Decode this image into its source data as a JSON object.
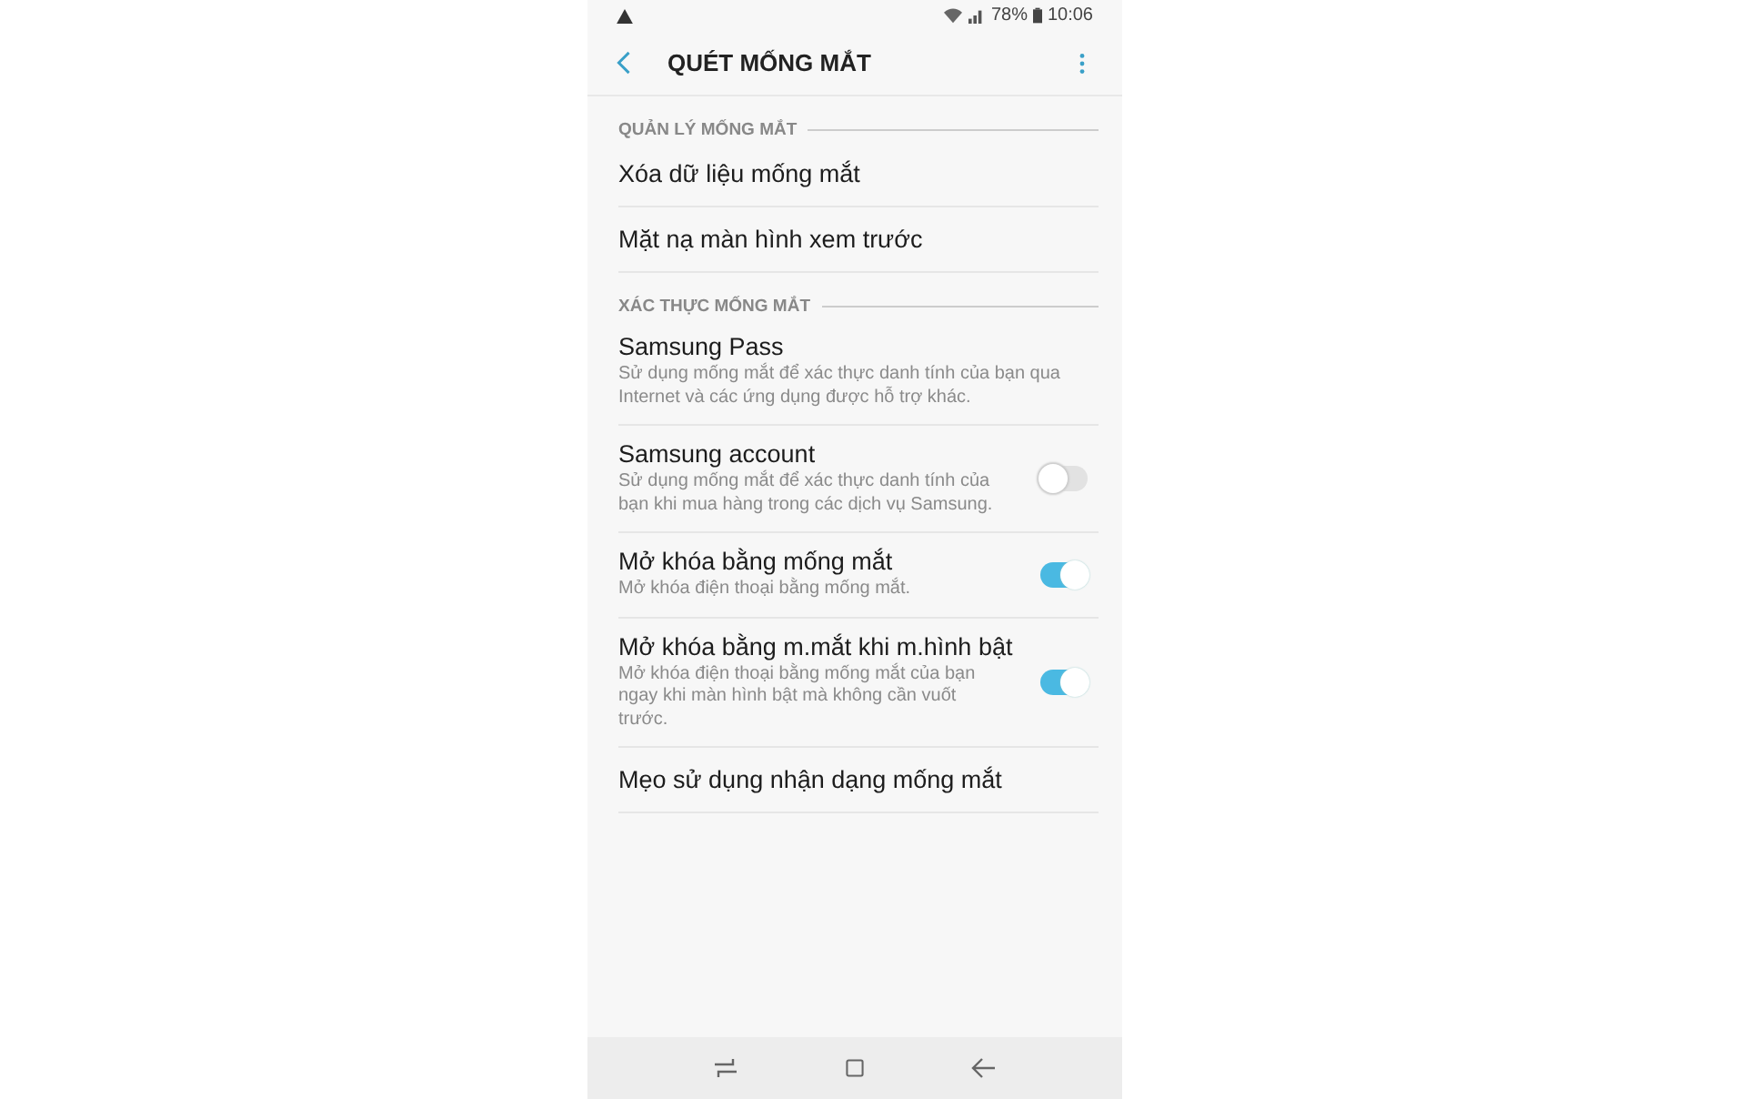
{
  "status_bar": {
    "battery": "78%",
    "time": "10:06"
  },
  "header": {
    "title": "QUÉT MỐNG MẮT"
  },
  "sections": [
    {
      "title": "QUẢN LÝ MỐNG MẮT",
      "items": [
        {
          "kind": "link",
          "title": "Xóa dữ liệu mống mắt"
        },
        {
          "kind": "link",
          "title": "Mặt nạ màn hình xem trước"
        }
      ]
    },
    {
      "title": "XÁC THỰC MỐNG MẮT",
      "items": [
        {
          "kind": "link",
          "title": "Samsung Pass",
          "description": "Sử dụng mống mắt để xác thực danh tính của bạn qua Internet và các ứng dụng được hỗ trợ khác."
        },
        {
          "kind": "switch",
          "title": "Samsung account",
          "description": "Sử dụng mống mắt để xác thực danh tính của bạn khi mua hàng trong các dịch vụ Samsung.",
          "on": false
        },
        {
          "kind": "switch",
          "title": "Mở khóa bằng mống mắt",
          "description": "Mở khóa điện thoại bằng mống mắt.",
          "on": true
        },
        {
          "kind": "switch",
          "title": "Mở khóa bằng m.mắt khi m.hình bật",
          "description": "Mở khóa điện thoại bằng mống mắt của bạn ngay khi màn hình bật mà không cần vuốt trước.",
          "on": true
        },
        {
          "kind": "link",
          "title": "Mẹo sử dụng nhận dạng mống mắt"
        }
      ]
    }
  ]
}
